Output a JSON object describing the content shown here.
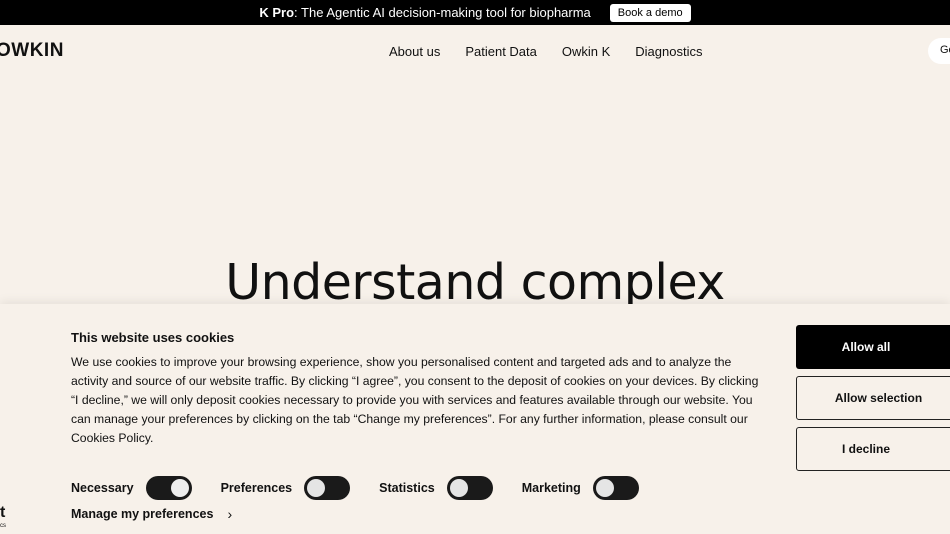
{
  "announcement": {
    "bold_text": "K Pro",
    "text": ": The Agentic AI decision-making tool for biopharma",
    "button_label": "Book a demo"
  },
  "nav": {
    "logo": "OWKIN",
    "links": [
      "About us",
      "Patient Data",
      "Owkin K",
      "Diagnostics"
    ],
    "cta_label": "Ge"
  },
  "hero": {
    "title": "Understand complex"
  },
  "cookie": {
    "title": "This website uses cookies",
    "body": "We use cookies to improve your browsing experience, show you personalised content and targeted ads and to analyze the activity and source of our website traffic. By clicking “I agree”, you consent to the deposit of cookies on your devices. By clicking “I decline,” we will only deposit cookies necessary to provide you with services and features available through our website. You can manage your preferences by clicking on the tab “Change my preferences”. For any further information, please consult our Cookies Policy.",
    "toggles": [
      {
        "label": "Necessary",
        "state": "on"
      },
      {
        "label": "Preferences",
        "state": "off"
      },
      {
        "label": "Statistics",
        "state": "off"
      },
      {
        "label": "Marketing",
        "state": "off"
      }
    ],
    "manage_label": "Manage my preferences",
    "buttons": {
      "allow_all": "Allow all",
      "allow_selection": "Allow selection",
      "decline": "I decline"
    }
  },
  "corner": {
    "mark": "t",
    "sub": "cs"
  }
}
